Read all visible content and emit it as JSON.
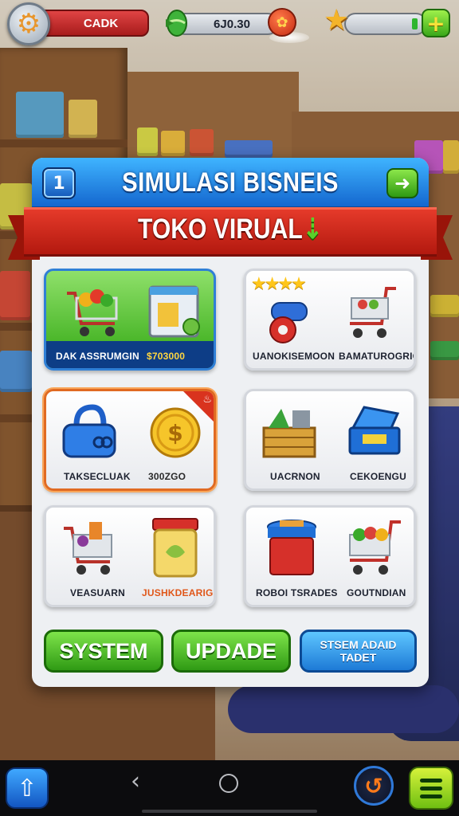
{
  "hud": {
    "player_name": "CADK",
    "money": "6J0.30",
    "icons": {
      "settings": "gear-icon",
      "money": "leaf-icon",
      "coin": "coin-icon",
      "level": "star-icon",
      "add": "plus-icon"
    },
    "xp_fill_fraction": 0.08
  },
  "panel": {
    "level": "1",
    "title": "SIMULASI BISNEIS",
    "subtitle": "TOKO VIRUAL",
    "next_icon": "chevron-right-icon"
  },
  "cards": [
    {
      "label": "DAK ASSRUMGIN",
      "price": "$703000",
      "icon": "shopping-cart-icon",
      "icon2": "register-box-icon",
      "style": "green"
    },
    {
      "label_left": "UANOKISEMOON",
      "label_right": "BAMATUROGRION",
      "rating": 4,
      "icon": "conveyor-roll-icon",
      "icon2": "shopping-cart-icon"
    },
    {
      "label": "TAKSECLUAK",
      "price": "300ZGO",
      "icon": "bag-icon",
      "icon2": "gold-coin-icon",
      "style": "orange",
      "badge": "fire-icon"
    },
    {
      "label_left": "UACRNON",
      "label_right": "CEKOENGU",
      "icon": "produce-crate-icon",
      "icon2": "cash-box-icon"
    },
    {
      "label_left": "VEASUARN",
      "label_right": "JUSHKDEARIGG",
      "icon": "shopping-cart-icon",
      "icon2": "jar-icon"
    },
    {
      "label_left": "ROBOI TSRADES",
      "label_right": "GOUTNDIAN",
      "icon": "storage-bin-icon",
      "icon2": "shopping-cart-icon"
    }
  ],
  "buttons": {
    "system": "SYSTEM",
    "update": "UPDADE",
    "extra_line1": "STSEM ADAID",
    "extra_line2": "TADET"
  },
  "navbar": {
    "icons": [
      "home-arrow-icon",
      "back-icon",
      "home-circle-icon",
      "refresh-icon",
      "menu-icon"
    ]
  },
  "colors": {
    "header_blue": "#1467cf",
    "ribbon_red": "#c8201a",
    "button_green": "#2f9a14",
    "button_blue": "#1d7ad6",
    "price_yellow": "#ffd640"
  }
}
